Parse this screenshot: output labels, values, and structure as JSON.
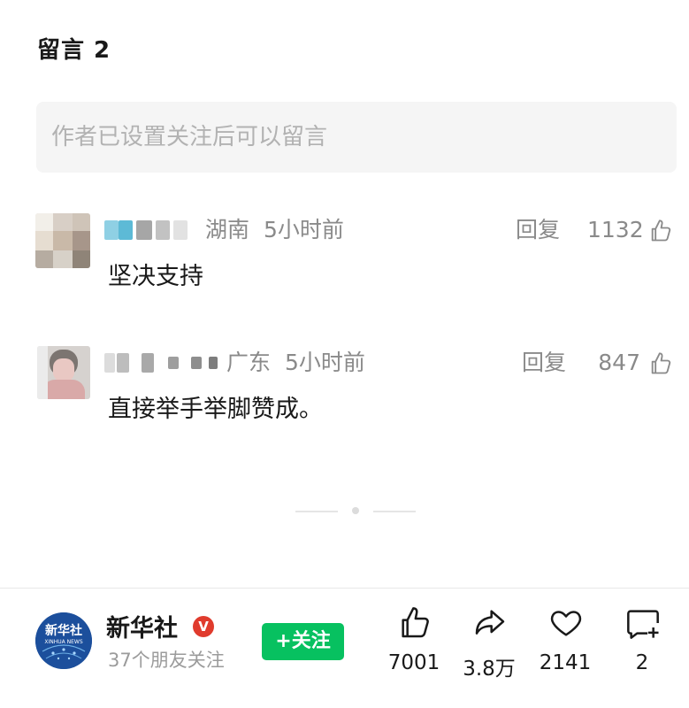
{
  "header": {
    "title": "留言 2"
  },
  "comment_input": {
    "placeholder": "作者已设置关注后可以留言"
  },
  "comments": [
    {
      "location": "湖南",
      "time": "5小时前",
      "reply_label": "回复",
      "likes": "1132",
      "text": "坚决支持"
    },
    {
      "location": "广东",
      "time": "5小时前",
      "reply_label": "回复",
      "likes": "847",
      "text": "直接举手举脚赞成。"
    }
  ],
  "account": {
    "name": "新华社",
    "verified_badge": "V",
    "friends_following": "37个朋友关注",
    "follow_label": "+关注",
    "logo_text": "新华社",
    "logo_subtext": "XINHUA NEWS"
  },
  "actions": {
    "like_count": "7001",
    "share_count": "3.8万",
    "favorite_count": "2141",
    "comment_count": "2"
  },
  "colors": {
    "accent_green": "#07c160",
    "verified_red": "#e03b2d",
    "logo_blue": "#1c4f9c"
  },
  "icons": [
    "thumb-up-icon",
    "share-icon",
    "heart-icon",
    "comment-add-icon",
    "verified-icon"
  ]
}
